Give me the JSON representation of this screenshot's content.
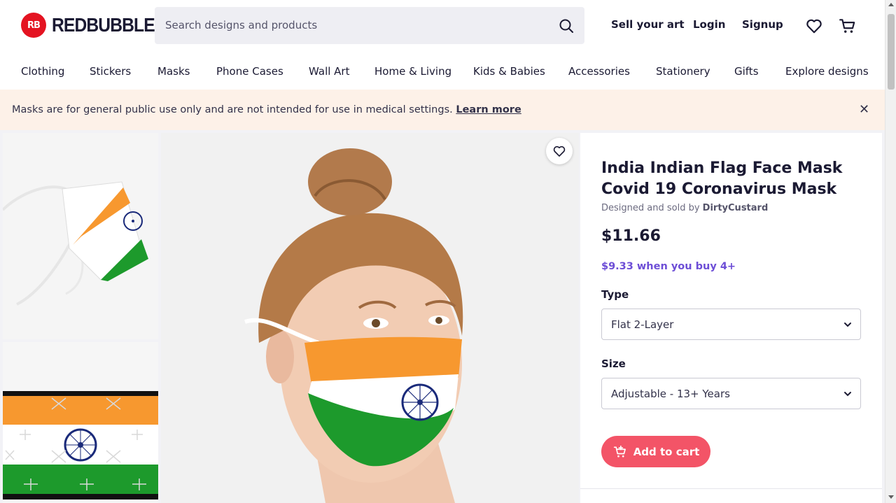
{
  "header": {
    "logo_badge": "RB",
    "logo_text": "REDBUBBLE",
    "search_placeholder": "Search designs and products",
    "sell_label": "Sell your art",
    "login_label": "Login",
    "signup_label": "Signup",
    "icons": [
      "search-icon",
      "heart-icon",
      "cart-icon"
    ]
  },
  "nav": {
    "items": [
      "Clothing",
      "Stickers",
      "Masks",
      "Phone Cases",
      "Wall Art",
      "Home & Living",
      "Kids & Babies",
      "Accessories",
      "Stationery",
      "Gifts",
      "Explore designs"
    ]
  },
  "notice": {
    "text": "Masks are for general public use only and are not intended for use in medical settings.",
    "link": "Learn more",
    "close": "✕"
  },
  "product": {
    "title": "India Indian Flag Face Mask Covid 19 Coronavirus Mask",
    "byline_prefix": "Designed and sold by",
    "artist": "DirtyCustard",
    "price": "$11.66",
    "bulk_price": "$9.33 when you buy 4+",
    "type_label": "Type",
    "type_value": "Flat 2-Layer",
    "size_label": "Size",
    "size_value": "Adjustable - 13+ Years",
    "add_to_cart": "Add to cart"
  },
  "colors": {
    "brand_red": "#e41321",
    "cart_button": "#f35467",
    "bulk_price": "#6d4ed6",
    "notice_bg": "#fdf1e8",
    "flag_saffron": "#f7982f",
    "flag_green": "#1d9a2c",
    "flag_navy": "#1a2a7a"
  }
}
